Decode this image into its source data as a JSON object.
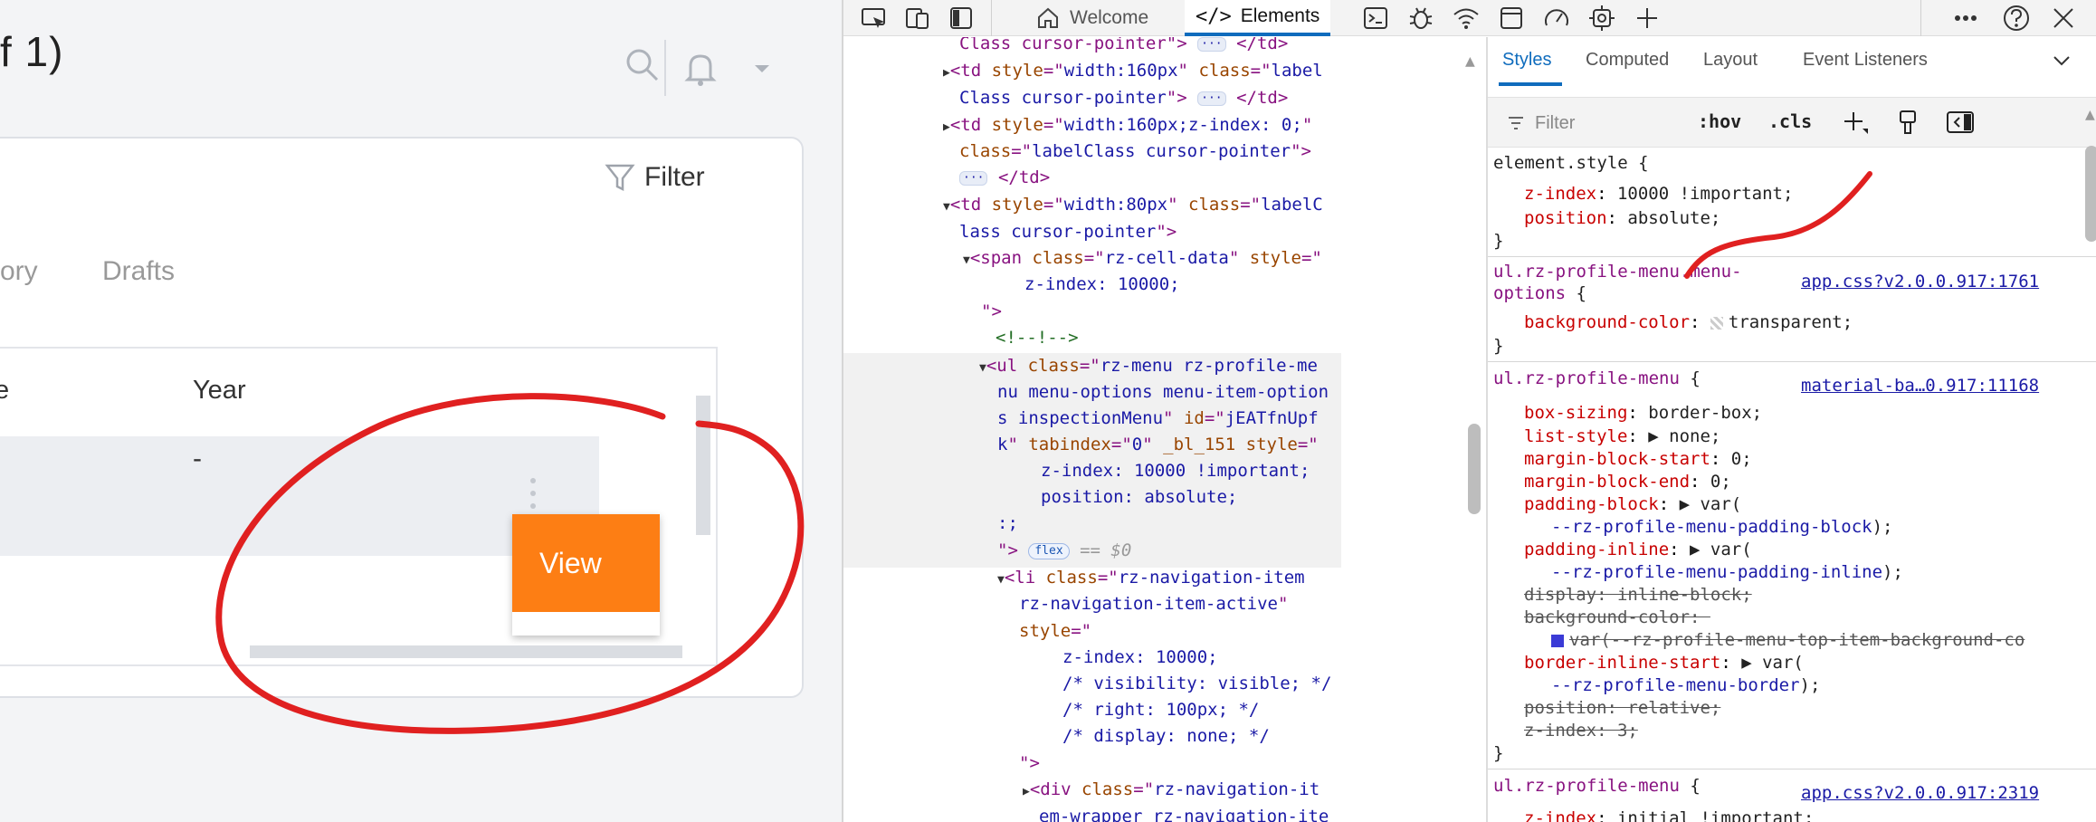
{
  "app": {
    "title": "f 1)",
    "filter_label": "Filter",
    "tabs": [
      "ory",
      "Drafts"
    ],
    "table": {
      "headers": [
        "e",
        "Year"
      ],
      "rows": [
        [
          "-"
        ]
      ]
    },
    "menu": {
      "view_label": "View"
    },
    "accent": "#fd7e14"
  },
  "devtools": {
    "tabs": {
      "welcome": "Welcome",
      "elements": "Elements"
    },
    "toolbar_icons": [
      "inspect-icon",
      "device-emulation-icon",
      "sidebar-toggle-icon",
      "console-icon",
      "sources-bug-icon",
      "network-icon",
      "application-icon",
      "performance-icon",
      "settings-gear-icon",
      "add-tool-icon",
      "more-icon",
      "help-icon",
      "close-icon"
    ],
    "styles_tabs": [
      "Styles",
      "Computed",
      "Layout",
      "Event Listeners"
    ],
    "filter_placeholder": "Filter",
    "hov": ":hov",
    "cls": ".cls",
    "selected_marker": "== $0",
    "flex_badge": "flex"
  },
  "annotation_color": "#e02020"
}
